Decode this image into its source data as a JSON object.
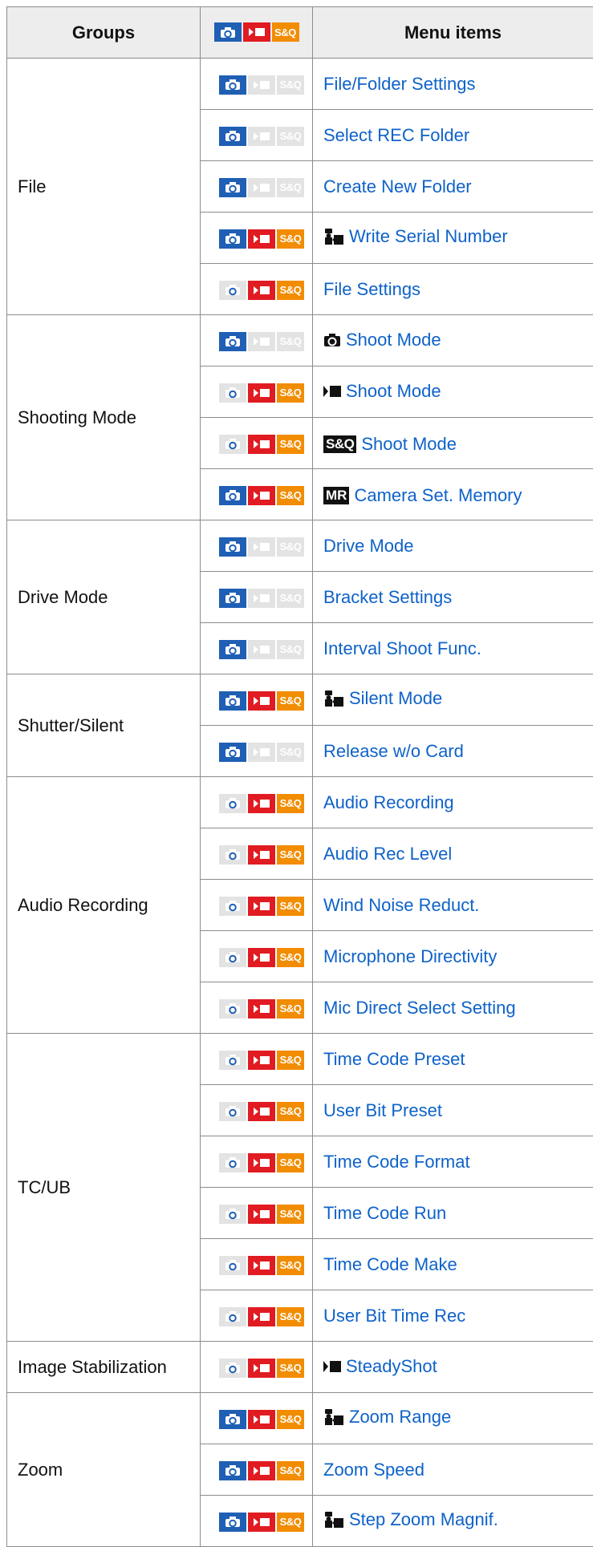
{
  "colors": {
    "photo": "#1f5fb4",
    "movie": "#e11b22",
    "sq": "#f28c00",
    "off": "#e3e3e3",
    "link": "#0e62c9"
  },
  "header": {
    "groups": "Groups",
    "menu_items": "Menu items",
    "mode_icons": [
      "photo",
      "movie",
      "sq"
    ]
  },
  "mode_icon_text": {
    "sq": "S&Q"
  },
  "prefix_text": {
    "sq": "S&Q",
    "mr": "MR"
  },
  "rows": [
    {
      "group": "File",
      "span": 5,
      "modes": [
        1,
        0,
        0
      ],
      "prefix": "",
      "label": "File/Folder Settings"
    },
    {
      "modes": [
        1,
        0,
        0
      ],
      "prefix": "",
      "label": "Select REC Folder"
    },
    {
      "modes": [
        1,
        0,
        0
      ],
      "prefix": "",
      "label": "Create New Folder"
    },
    {
      "modes": [
        1,
        1,
        1
      ],
      "prefix": "mix-icon",
      "label": "Write Serial Number"
    },
    {
      "modes": [
        0,
        1,
        1
      ],
      "prefix": "",
      "label": "File Settings"
    },
    {
      "group": "Shooting Mode",
      "span": 4,
      "modes": [
        1,
        0,
        0
      ],
      "prefix": "camera-icon",
      "label": "Shoot Mode"
    },
    {
      "modes": [
        0,
        1,
        1
      ],
      "prefix": "movie-icon",
      "label": "Shoot Mode"
    },
    {
      "modes": [
        0,
        1,
        1
      ],
      "prefix": "sq-icon",
      "label": "Shoot Mode"
    },
    {
      "modes": [
        1,
        1,
        1
      ],
      "prefix": "mr-icon",
      "label": "Camera Set. Memory"
    },
    {
      "group": "Drive Mode",
      "span": 3,
      "modes": [
        1,
        0,
        0
      ],
      "prefix": "",
      "label": "Drive Mode"
    },
    {
      "modes": [
        1,
        0,
        0
      ],
      "prefix": "",
      "label": "Bracket Settings"
    },
    {
      "modes": [
        1,
        0,
        0
      ],
      "prefix": "",
      "label": "Interval Shoot Func."
    },
    {
      "group": "Shutter/Silent",
      "span": 2,
      "modes": [
        1,
        1,
        1
      ],
      "prefix": "mix-icon",
      "label": "Silent Mode"
    },
    {
      "modes": [
        1,
        0,
        0
      ],
      "prefix": "",
      "label": "Release w/o Card"
    },
    {
      "group": "Audio Recording",
      "span": 5,
      "modes": [
        0,
        1,
        1
      ],
      "prefix": "",
      "label": "Audio Recording"
    },
    {
      "modes": [
        0,
        1,
        1
      ],
      "prefix": "",
      "label": "Audio Rec Level"
    },
    {
      "modes": [
        0,
        1,
        1
      ],
      "prefix": "",
      "label": "Wind Noise Reduct."
    },
    {
      "modes": [
        0,
        1,
        1
      ],
      "prefix": "",
      "label": "Microphone Directivity"
    },
    {
      "modes": [
        0,
        1,
        1
      ],
      "prefix": "",
      "label": "Mic Direct Select Setting"
    },
    {
      "group": "TC/UB",
      "span": 6,
      "modes": [
        0,
        1,
        1
      ],
      "prefix": "",
      "label": "Time Code Preset"
    },
    {
      "modes": [
        0,
        1,
        1
      ],
      "prefix": "",
      "label": "User Bit Preset"
    },
    {
      "modes": [
        0,
        1,
        1
      ],
      "prefix": "",
      "label": "Time Code Format"
    },
    {
      "modes": [
        0,
        1,
        1
      ],
      "prefix": "",
      "label": "Time Code Run"
    },
    {
      "modes": [
        0,
        1,
        1
      ],
      "prefix": "",
      "label": "Time Code Make"
    },
    {
      "modes": [
        0,
        1,
        1
      ],
      "prefix": "",
      "label": "User Bit Time Rec"
    },
    {
      "group": "Image Stabilization",
      "span": 1,
      "modes": [
        0,
        1,
        1
      ],
      "prefix": "movie-icon",
      "label": "SteadyShot"
    },
    {
      "group": "Zoom",
      "span": 3,
      "modes": [
        1,
        1,
        1
      ],
      "prefix": "mix-icon",
      "label": "Zoom Range"
    },
    {
      "modes": [
        1,
        1,
        1
      ],
      "prefix": "",
      "label": "Zoom Speed"
    },
    {
      "modes": [
        1,
        1,
        1
      ],
      "prefix": "mix-icon",
      "label": "Step Zoom Magnif."
    }
  ]
}
